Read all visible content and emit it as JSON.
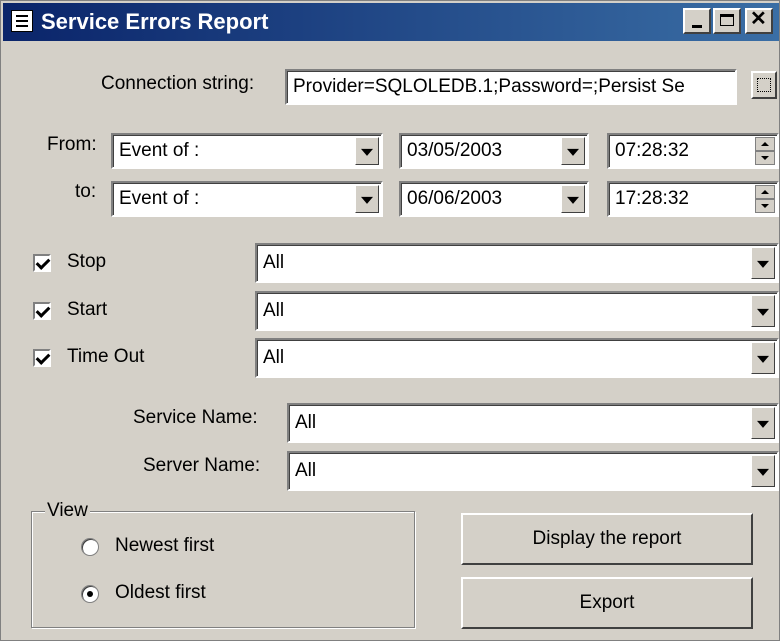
{
  "window": {
    "title": "Service Errors Report"
  },
  "connection": {
    "label": "Connection string:",
    "value": "Provider=SQLOLEDB.1;Password=;Persist Se"
  },
  "from": {
    "label": "From:",
    "event": "Event of :",
    "date": "03/05/2003",
    "time": "07:28:32"
  },
  "to": {
    "label": "to:",
    "event": "Event of :",
    "date": "06/06/2003",
    "time": "17:28:32"
  },
  "filters": [
    {
      "label": "Stop",
      "checked": true,
      "value": "All"
    },
    {
      "label": "Start",
      "checked": true,
      "value": "All"
    },
    {
      "label": "Time Out",
      "checked": true,
      "value": "All"
    }
  ],
  "service_name": {
    "label": "Service Name:",
    "value": "All"
  },
  "server_name": {
    "label": "Server Name:",
    "value": "All"
  },
  "view": {
    "label": "View",
    "options": [
      {
        "label": "Newest first",
        "selected": false
      },
      {
        "label": "Oldest first",
        "selected": true
      }
    ]
  },
  "buttons": {
    "display": "Display the report",
    "export": "Export"
  },
  "colors": {
    "titlebar_start": "#0a246a",
    "titlebar_end": "#3a6ea5",
    "face": "#d4d0c8"
  }
}
